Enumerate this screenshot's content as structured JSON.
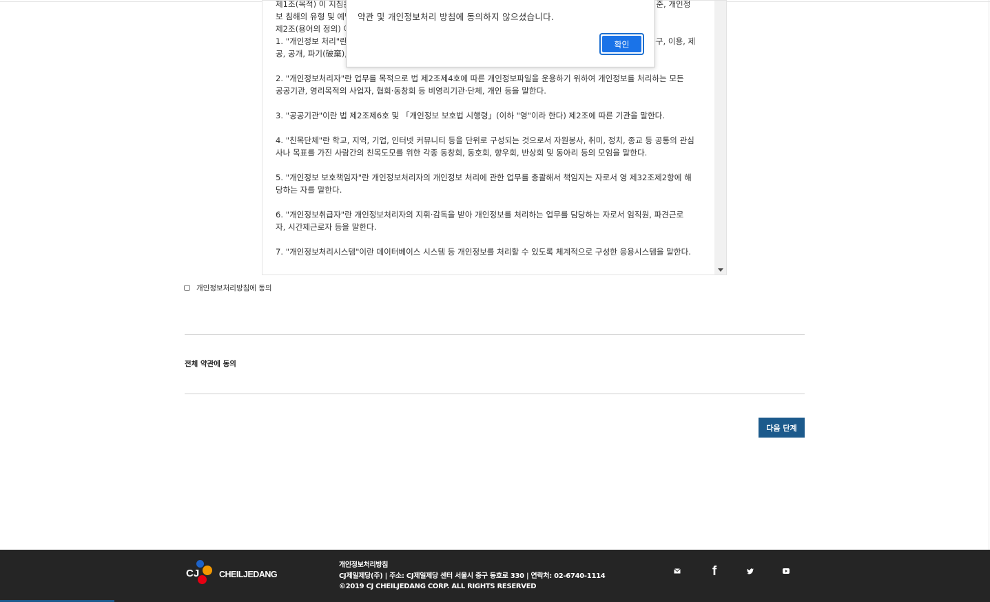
{
  "terms": {
    "lines": [
      " 제1조(목적) 이 지침은 「개인정보 보호법」(이하 \"법\"이라 한다) 제12조제1항에 따른 개인정보의 처리에 관한 기준, 개인정\n보 침해의 유형 및 예방조치 등에 관한 세부적인 사항을 규정함을 목적으로 한다.",
      " 제2조(용어의 정의) 이 지침에서 사용하는 용어의 뜻은 다음과 같다.\n1. \"개인정보 처리\"란 개인정보의 수집, 생성, 연계, 연동, 기록, 저장, 보유, 가공, 편집, 검색, 출력, 정정(訂正), 복구, 이용, 제\n공, 공개, 파기(破棄), 그 밖에 이와 유사한 행위를 말한다.",
      "2. \"개인정보처리자\"란 업무를 목적으로 법 제2조제4호에 따른 개인정보파일을 운용하기 위하여 개인정보를 처리하는 모든\n공공기관, 영리목적의 사업자, 협회·동창회 등 비영리기관·단체, 개인 등을 말한다.",
      "3. \"공공기관\"이란 법 제2조제6호 및 「개인정보 보호법 시행령」(이하 \"영\"이라 한다) 제2조에 따른 기관을 말한다.",
      "4. \"친목단체\"란 학교, 지역, 기업, 인터넷 커뮤니티 등을 단위로 구성되는 것으로서 자원봉사, 취미, 정치, 종교 등 공통의 관심\n사나 목표를 가진 사람간의 친목도모를 위한 각종 동창회, 동호회, 향우회, 반상회 및 동아리 등의 모임을 말한다.",
      "5. \"개인정보 보호책임자\"란 개인정보처리자의 개인정보 처리에 관한 업무를 총괄해서 책임지는 자로서 영 제32조제2항에 해\n당하는 자를 말한다.",
      "6. \"개인정보취급자\"란 개인정보처리자의 지휘·감독을 받아 개인정보를 처리하는 업무를 담당하는 자로서 임직원, 파견근로\n자, 시간제근로자 등을 말한다.",
      "7. \"개인정보처리시스템\"이란 데이터베이스 시스템 등 개인정보를 처리할 수 있도록 체계적으로 구성한 응용시스템을 말한다."
    ]
  },
  "privacy_agree_label": "개인정보처리방침에 동의",
  "all_agree_label": "전체 약관에 동의",
  "next_button": "다음 단계",
  "dialog": {
    "message": "약관 및 개인정보처리 방침에 동의하지 않으셨습니다.",
    "confirm": "확인"
  },
  "footer": {
    "logo_cj": "CJ",
    "logo_name": "CHEILJEDANG",
    "policy_link": "개인정보처리방침",
    "address": "CJ제일제당(주) | 주소: CJ제일제당 센터 서울시 중구 동호로 330 | 연락처: 02-6740-1114",
    "copyright": "©2019 CJ CHEILJEDANG CORP. ALL RIGHTS RESERVED",
    "social": [
      {
        "name": "mail-icon",
        "glyph": "✉"
      },
      {
        "name": "facebook-icon",
        "glyph": "f"
      },
      {
        "name": "twitter-icon",
        "glyph": "🐦"
      },
      {
        "name": "youtube-icon",
        "glyph": "▶"
      }
    ]
  },
  "colors": {
    "primary": "#1c5a8c",
    "footer_bg": "#252525",
    "dialog_button": "#1a73e8"
  }
}
